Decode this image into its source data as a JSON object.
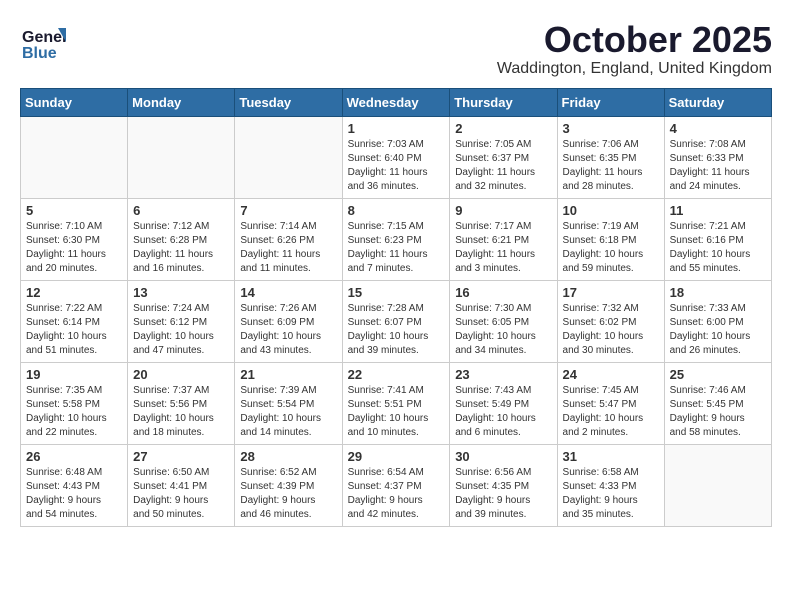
{
  "header": {
    "logo_line1": "General",
    "logo_line2": "Blue",
    "month": "October 2025",
    "location": "Waddington, England, United Kingdom"
  },
  "days_of_week": [
    "Sunday",
    "Monday",
    "Tuesday",
    "Wednesday",
    "Thursday",
    "Friday",
    "Saturday"
  ],
  "weeks": [
    [
      {
        "day": "",
        "info": ""
      },
      {
        "day": "",
        "info": ""
      },
      {
        "day": "",
        "info": ""
      },
      {
        "day": "1",
        "info": "Sunrise: 7:03 AM\nSunset: 6:40 PM\nDaylight: 11 hours\nand 36 minutes."
      },
      {
        "day": "2",
        "info": "Sunrise: 7:05 AM\nSunset: 6:37 PM\nDaylight: 11 hours\nand 32 minutes."
      },
      {
        "day": "3",
        "info": "Sunrise: 7:06 AM\nSunset: 6:35 PM\nDaylight: 11 hours\nand 28 minutes."
      },
      {
        "day": "4",
        "info": "Sunrise: 7:08 AM\nSunset: 6:33 PM\nDaylight: 11 hours\nand 24 minutes."
      }
    ],
    [
      {
        "day": "5",
        "info": "Sunrise: 7:10 AM\nSunset: 6:30 PM\nDaylight: 11 hours\nand 20 minutes."
      },
      {
        "day": "6",
        "info": "Sunrise: 7:12 AM\nSunset: 6:28 PM\nDaylight: 11 hours\nand 16 minutes."
      },
      {
        "day": "7",
        "info": "Sunrise: 7:14 AM\nSunset: 6:26 PM\nDaylight: 11 hours\nand 11 minutes."
      },
      {
        "day": "8",
        "info": "Sunrise: 7:15 AM\nSunset: 6:23 PM\nDaylight: 11 hours\nand 7 minutes."
      },
      {
        "day": "9",
        "info": "Sunrise: 7:17 AM\nSunset: 6:21 PM\nDaylight: 11 hours\nand 3 minutes."
      },
      {
        "day": "10",
        "info": "Sunrise: 7:19 AM\nSunset: 6:18 PM\nDaylight: 10 hours\nand 59 minutes."
      },
      {
        "day": "11",
        "info": "Sunrise: 7:21 AM\nSunset: 6:16 PM\nDaylight: 10 hours\nand 55 minutes."
      }
    ],
    [
      {
        "day": "12",
        "info": "Sunrise: 7:22 AM\nSunset: 6:14 PM\nDaylight: 10 hours\nand 51 minutes."
      },
      {
        "day": "13",
        "info": "Sunrise: 7:24 AM\nSunset: 6:12 PM\nDaylight: 10 hours\nand 47 minutes."
      },
      {
        "day": "14",
        "info": "Sunrise: 7:26 AM\nSunset: 6:09 PM\nDaylight: 10 hours\nand 43 minutes."
      },
      {
        "day": "15",
        "info": "Sunrise: 7:28 AM\nSunset: 6:07 PM\nDaylight: 10 hours\nand 39 minutes."
      },
      {
        "day": "16",
        "info": "Sunrise: 7:30 AM\nSunset: 6:05 PM\nDaylight: 10 hours\nand 34 minutes."
      },
      {
        "day": "17",
        "info": "Sunrise: 7:32 AM\nSunset: 6:02 PM\nDaylight: 10 hours\nand 30 minutes."
      },
      {
        "day": "18",
        "info": "Sunrise: 7:33 AM\nSunset: 6:00 PM\nDaylight: 10 hours\nand 26 minutes."
      }
    ],
    [
      {
        "day": "19",
        "info": "Sunrise: 7:35 AM\nSunset: 5:58 PM\nDaylight: 10 hours\nand 22 minutes."
      },
      {
        "day": "20",
        "info": "Sunrise: 7:37 AM\nSunset: 5:56 PM\nDaylight: 10 hours\nand 18 minutes."
      },
      {
        "day": "21",
        "info": "Sunrise: 7:39 AM\nSunset: 5:54 PM\nDaylight: 10 hours\nand 14 minutes."
      },
      {
        "day": "22",
        "info": "Sunrise: 7:41 AM\nSunset: 5:51 PM\nDaylight: 10 hours\nand 10 minutes."
      },
      {
        "day": "23",
        "info": "Sunrise: 7:43 AM\nSunset: 5:49 PM\nDaylight: 10 hours\nand 6 minutes."
      },
      {
        "day": "24",
        "info": "Sunrise: 7:45 AM\nSunset: 5:47 PM\nDaylight: 10 hours\nand 2 minutes."
      },
      {
        "day": "25",
        "info": "Sunrise: 7:46 AM\nSunset: 5:45 PM\nDaylight: 9 hours\nand 58 minutes."
      }
    ],
    [
      {
        "day": "26",
        "info": "Sunrise: 6:48 AM\nSunset: 4:43 PM\nDaylight: 9 hours\nand 54 minutes."
      },
      {
        "day": "27",
        "info": "Sunrise: 6:50 AM\nSunset: 4:41 PM\nDaylight: 9 hours\nand 50 minutes."
      },
      {
        "day": "28",
        "info": "Sunrise: 6:52 AM\nSunset: 4:39 PM\nDaylight: 9 hours\nand 46 minutes."
      },
      {
        "day": "29",
        "info": "Sunrise: 6:54 AM\nSunset: 4:37 PM\nDaylight: 9 hours\nand 42 minutes."
      },
      {
        "day": "30",
        "info": "Sunrise: 6:56 AM\nSunset: 4:35 PM\nDaylight: 9 hours\nand 39 minutes."
      },
      {
        "day": "31",
        "info": "Sunrise: 6:58 AM\nSunset: 4:33 PM\nDaylight: 9 hours\nand 35 minutes."
      },
      {
        "day": "",
        "info": ""
      }
    ]
  ]
}
